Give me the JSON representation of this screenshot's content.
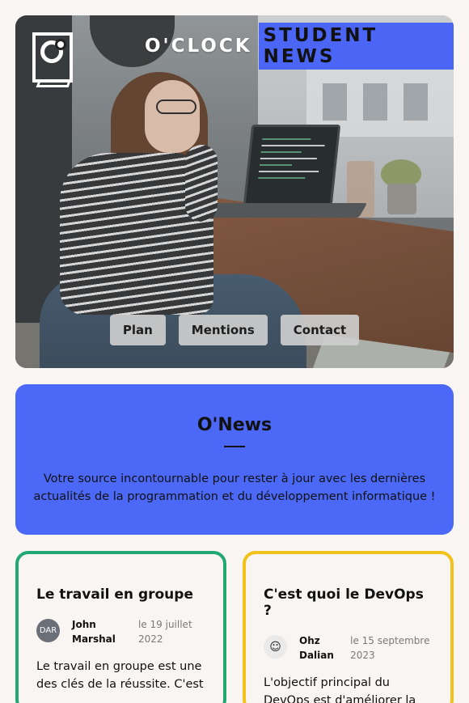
{
  "header": {
    "title_part1": "O'CLOCK",
    "title_part2": "STUDENT NEWS",
    "logo_icon": "oclock-logo-icon",
    "accent_color": "#4b65f5"
  },
  "nav": {
    "items": [
      {
        "label": "Plan"
      },
      {
        "label": "Mentions"
      },
      {
        "label": "Contact"
      }
    ]
  },
  "intro": {
    "title": "O'News",
    "description": "Votre source incontournable pour rester à jour avec les dernières actualités de la programmation et du développement informatique !",
    "background_color": "#4b69f6"
  },
  "articles": [
    {
      "title": "Le travail en groupe",
      "avatar_text": "DAR",
      "author_line1": "John",
      "author_line2": "Marshal",
      "date_line1": "le 19 juillet",
      "date_line2": "2022",
      "excerpt": "Le travail en groupe est une des clés de la réussite. C'est",
      "border_color": "#22a873"
    },
    {
      "title": "C'est quoi le DevOps ?",
      "avatar_text": "☺",
      "author_line1": "Ohz",
      "author_line2": "Dalian",
      "date_line1": "le 15 septembre",
      "date_line2": "2023",
      "excerpt": "L'objectif principal du DevOps est d'améliorer la",
      "border_color": "#f2c21b"
    }
  ]
}
